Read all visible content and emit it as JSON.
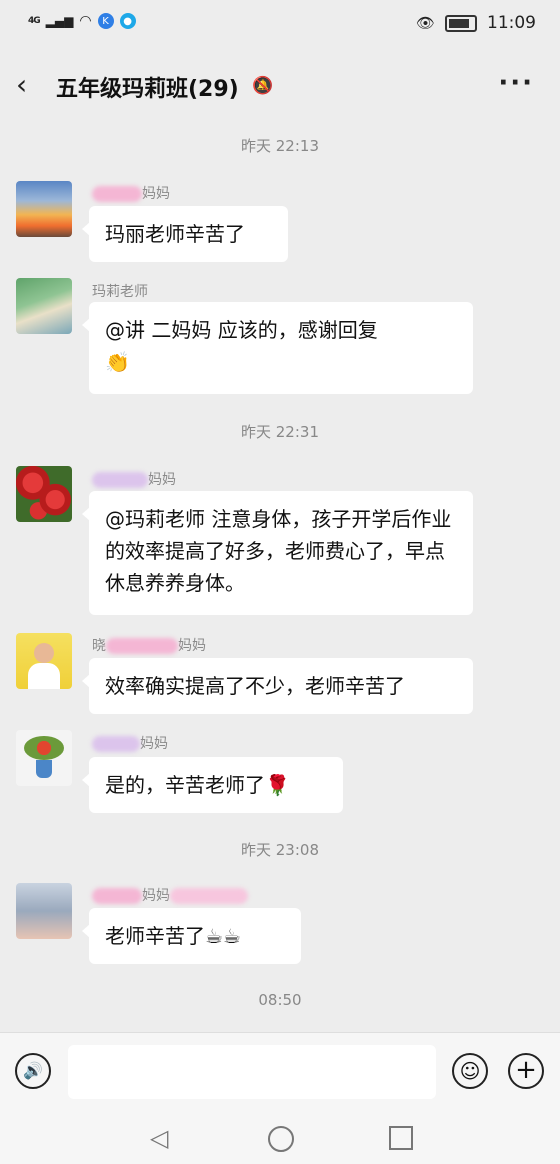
{
  "status_bar": {
    "signal": "4G",
    "time": "11:09"
  },
  "header": {
    "back_icon": "‹",
    "title": "五年级玛莉班(29)",
    "mute_icon": "🔕",
    "more_icon": "···"
  },
  "timestamps": [
    "昨天 22:13",
    "昨天 22:31",
    "昨天 23:08",
    "08:50"
  ],
  "messages": [
    {
      "sender": "妈妈",
      "text": "玛丽老师辛苦了"
    },
    {
      "sender": "玛莉老师",
      "text_line1": "@讲  二妈妈  应该的，感谢回复",
      "text_line2": "👏"
    },
    {
      "sender": "妈妈",
      "text": "@玛莉老师  注意身体，孩子开学后作业的效率提高了好多，老师费心了，早点休息养养身体。"
    },
    {
      "sender": "妈妈",
      "sender_prefix": "晓",
      "text": "效率确实提高了不少，老师辛苦了"
    },
    {
      "sender": "妈妈",
      "text": "是的，辛苦老师了🌹"
    },
    {
      "sender": "妈妈",
      "text": "老师辛苦了☕☕"
    }
  ],
  "input_bar": {
    "voice_icon": "🔊",
    "emoji_icon": "☺",
    "plus_icon": "+"
  },
  "nav_keys": {
    "back": "◁"
  }
}
